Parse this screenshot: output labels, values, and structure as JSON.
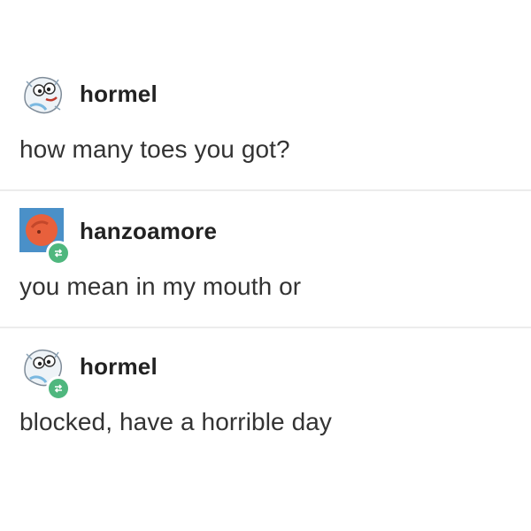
{
  "posts": [
    {
      "username": "hormel",
      "message": "how many toes you got?",
      "avatar_icon": "cartoon-character-avatar-icon",
      "reblogged": false
    },
    {
      "username": "hanzoamore",
      "message": "you mean in my mouth or",
      "avatar_icon": "orange-circle-avatar-icon",
      "reblogged": true
    },
    {
      "username": "hormel",
      "message": "blocked, have a horrible day",
      "avatar_icon": "cartoon-character-avatar-icon",
      "reblogged": true
    }
  ],
  "colors": {
    "reblog_badge": "#4fb77e",
    "avatar_blue": "#4a90c8",
    "avatar_orange": "#e8603c",
    "divider": "#ececec"
  }
}
